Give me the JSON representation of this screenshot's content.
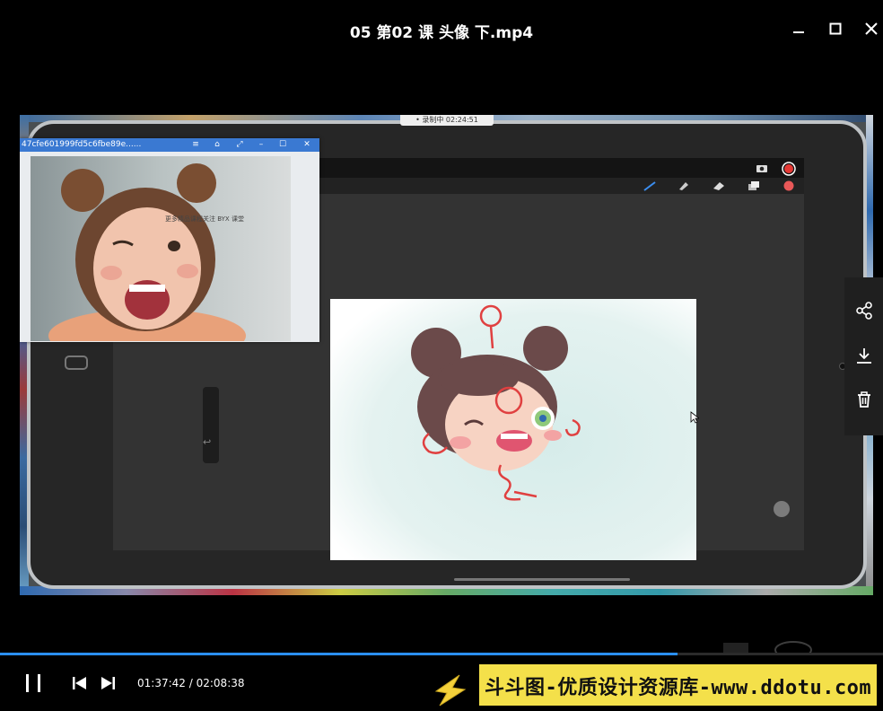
{
  "window": {
    "title": "05 第02 课 头像 下.mp4"
  },
  "video": {
    "recording_badge": "• 录制中 02:24:51",
    "popup_title": "47cfe601999fd5c6fbe89e......",
    "watermark_line1": "更多精品课程关注 BYX 课堂"
  },
  "player": {
    "current_time": "01:37:42",
    "separator": "/",
    "total_time": "02:08:38",
    "progress_fraction": 0.767
  },
  "banner": {
    "text": "斗斗图-优质设计资源库-www.ddotu.com"
  },
  "side_panel": {
    "icons": [
      "share-icon",
      "download-icon",
      "trash-icon"
    ]
  },
  "colors": {
    "accent": "#2a8ff0",
    "banner_bg": "#f4e04a",
    "popup_titlebar": "#3a79d2"
  }
}
